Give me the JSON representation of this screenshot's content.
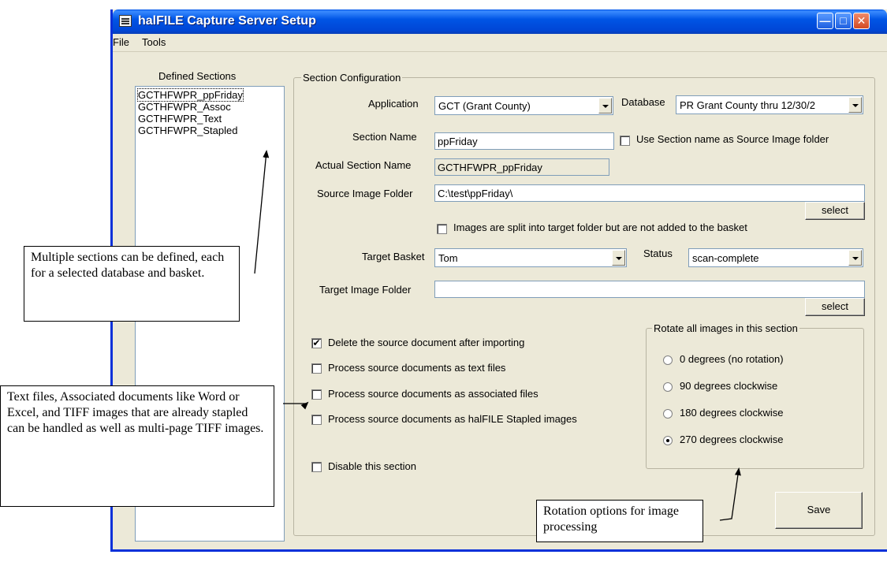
{
  "window": {
    "title": "halFILE Capture Server Setup"
  },
  "menu": {
    "file": "File",
    "tools": "Tools"
  },
  "defined_sections": {
    "title": "Defined Sections",
    "items": [
      "GCTHFWPR_ppFriday",
      "GCTHFWPR_Assoc",
      "GCTHFWPR_Text",
      "GCTHFWPR_Stapled"
    ],
    "selected_index": 0
  },
  "config": {
    "title": "Section Configuration",
    "application_label": "Application",
    "application_value": "GCT  (Grant County)",
    "database_label": "Database",
    "database_value": "PR Grant County thru 12/30/2",
    "section_name_label": "Section Name",
    "section_name_value": "ppFriday",
    "use_section_name_label": "Use Section name as Source Image folder",
    "actual_section_name_label": "Actual Section Name",
    "actual_section_name_value": "GCTHFWPR_ppFriday",
    "source_folder_label": "Source Image Folder",
    "source_folder_value": "C:\\test\\ppFriday\\",
    "select_label": "select",
    "split_label": "Images are split into target folder but are not added to the basket",
    "target_basket_label": "Target Basket",
    "target_basket_value": "Tom",
    "status_label": "Status",
    "status_value": "scan-complete",
    "target_folder_label": "Target Image Folder",
    "target_folder_value": "",
    "options": [
      {
        "label": "Delete the source document after importing",
        "checked": true
      },
      {
        "label": "Process source documents as text files",
        "checked": false
      },
      {
        "label": "Process source documents as associated files",
        "checked": false
      },
      {
        "label": "Process source documents as halFILE Stapled images",
        "checked": false
      }
    ],
    "disable_label": "Disable this section",
    "save_label": "Save"
  },
  "rotation": {
    "title": "Rotate all images in this section",
    "options": [
      "0 degrees (no rotation)",
      "90 degrees clockwise",
      "180 degrees clockwise",
      "270 degrees clockwise"
    ],
    "selected_index": 3
  },
  "callouts": {
    "sections": "Multiple sections can be defined, each for a selected database and basket.",
    "files": "Text files, Associated documents like Word or Excel, and TIFF images that are already stapled can be handled as well as multi-page TIFF images.",
    "rotation": "Rotation options for image processing"
  }
}
